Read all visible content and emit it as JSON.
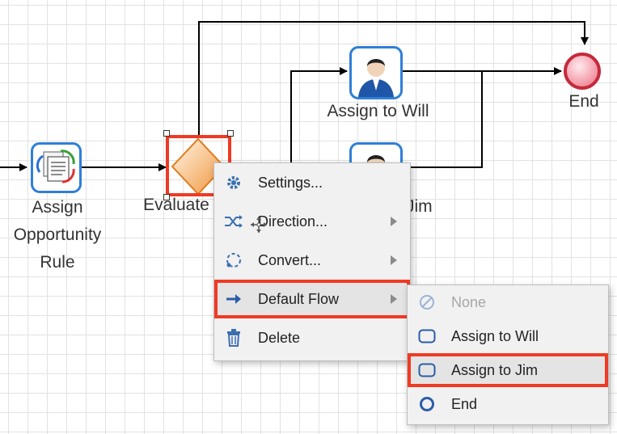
{
  "diagram": {
    "nodes": {
      "assign_opportunity_rule": {
        "label_line1": "Assign",
        "label_line2": "Opportunity",
        "label_line3": "Rule"
      },
      "evaluate": {
        "label": "Evaluate"
      },
      "assign_to_will": {
        "label": "Assign to Will"
      },
      "assign_to_jim": {
        "label_partial": "Jim"
      },
      "end": {
        "label": "End"
      }
    }
  },
  "context_menu": {
    "items": [
      {
        "label": "Settings...",
        "icon": "gear-icon",
        "has_submenu": false
      },
      {
        "label": "Direction...",
        "icon": "shuffle-icon",
        "has_submenu": true
      },
      {
        "label": "Convert...",
        "icon": "convert-icon",
        "has_submenu": true
      },
      {
        "label": "Default Flow",
        "icon": "arrow-right-icon",
        "has_submenu": true
      },
      {
        "label": "Delete",
        "icon": "trash-icon",
        "has_submenu": false
      }
    ]
  },
  "submenu": {
    "items": [
      {
        "label": "None",
        "icon": "none-icon",
        "disabled": true
      },
      {
        "label": "Assign to Will",
        "icon": "task-icon"
      },
      {
        "label": "Assign to Jim",
        "icon": "task-icon"
      },
      {
        "label": "End",
        "icon": "end-event-icon"
      }
    ]
  },
  "colors": {
    "highlight": "#ef3a24",
    "task_border": "#2f7fd8",
    "end_border": "#c52a3c",
    "gateway": "#f09a3e"
  }
}
